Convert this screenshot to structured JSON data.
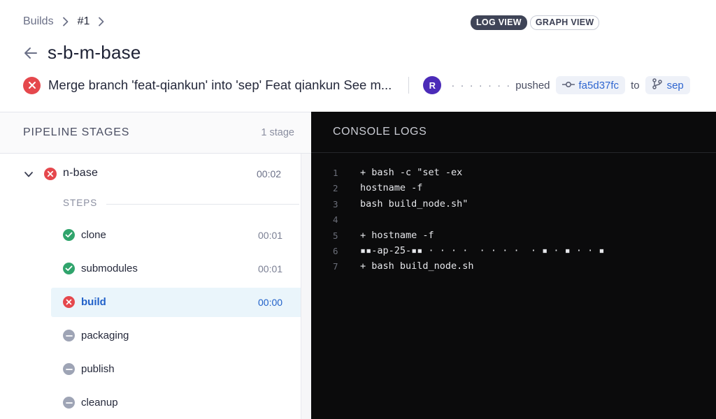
{
  "breadcrumb": {
    "root": "Builds",
    "current": "#1"
  },
  "view_toggle": {
    "log": "LOG VIEW",
    "graph": "GRAPH VIEW"
  },
  "title": {
    "repo": "s-b-m-base"
  },
  "commit": {
    "message": "Merge branch 'feat-qiankun' into 'sep' Feat qiankun See m...",
    "avatar_initial": "R",
    "author": "· · · ·  · · ·",
    "pushed_label": "pushed",
    "hash": "fa5d37fc",
    "to_label": "to",
    "branch": "sep"
  },
  "pipeline": {
    "title": "PIPELINE STAGES",
    "count": "1 stage",
    "stage": {
      "name": "n-base",
      "duration": "00:02",
      "status": "failed"
    },
    "steps_label": "STEPS",
    "steps": [
      {
        "name": "clone",
        "duration": "00:01",
        "status": "success"
      },
      {
        "name": "submodules",
        "duration": "00:01",
        "status": "success"
      },
      {
        "name": "build",
        "duration": "00:00",
        "status": "failed"
      },
      {
        "name": "packaging",
        "duration": "",
        "status": "skipped"
      },
      {
        "name": "publish",
        "duration": "",
        "status": "skipped"
      },
      {
        "name": "cleanup",
        "duration": "",
        "status": "skipped"
      }
    ]
  },
  "console": {
    "title": "CONSOLE LOGS",
    "lines": [
      {
        "n": "1",
        "text": "+ bash -c \"set -ex"
      },
      {
        "n": "2",
        "text": "hostname -f"
      },
      {
        "n": "3",
        "text": "bash build_node.sh\""
      },
      {
        "n": "4",
        "text": ""
      },
      {
        "n": "5",
        "text": "+ hostname -f"
      },
      {
        "n": "6",
        "text": "▪▪-ap-25-▪▪ · · · ·  · · · ·  · ▪ · ▪ · · ▪"
      },
      {
        "n": "7",
        "text": "+ bash build_node.sh"
      }
    ]
  },
  "colors": {
    "fail": "#e5484d",
    "success": "#30a46c",
    "skipped": "#9ea4b5",
    "link": "#2f66d0",
    "console_bg": "#0b0b0c"
  }
}
